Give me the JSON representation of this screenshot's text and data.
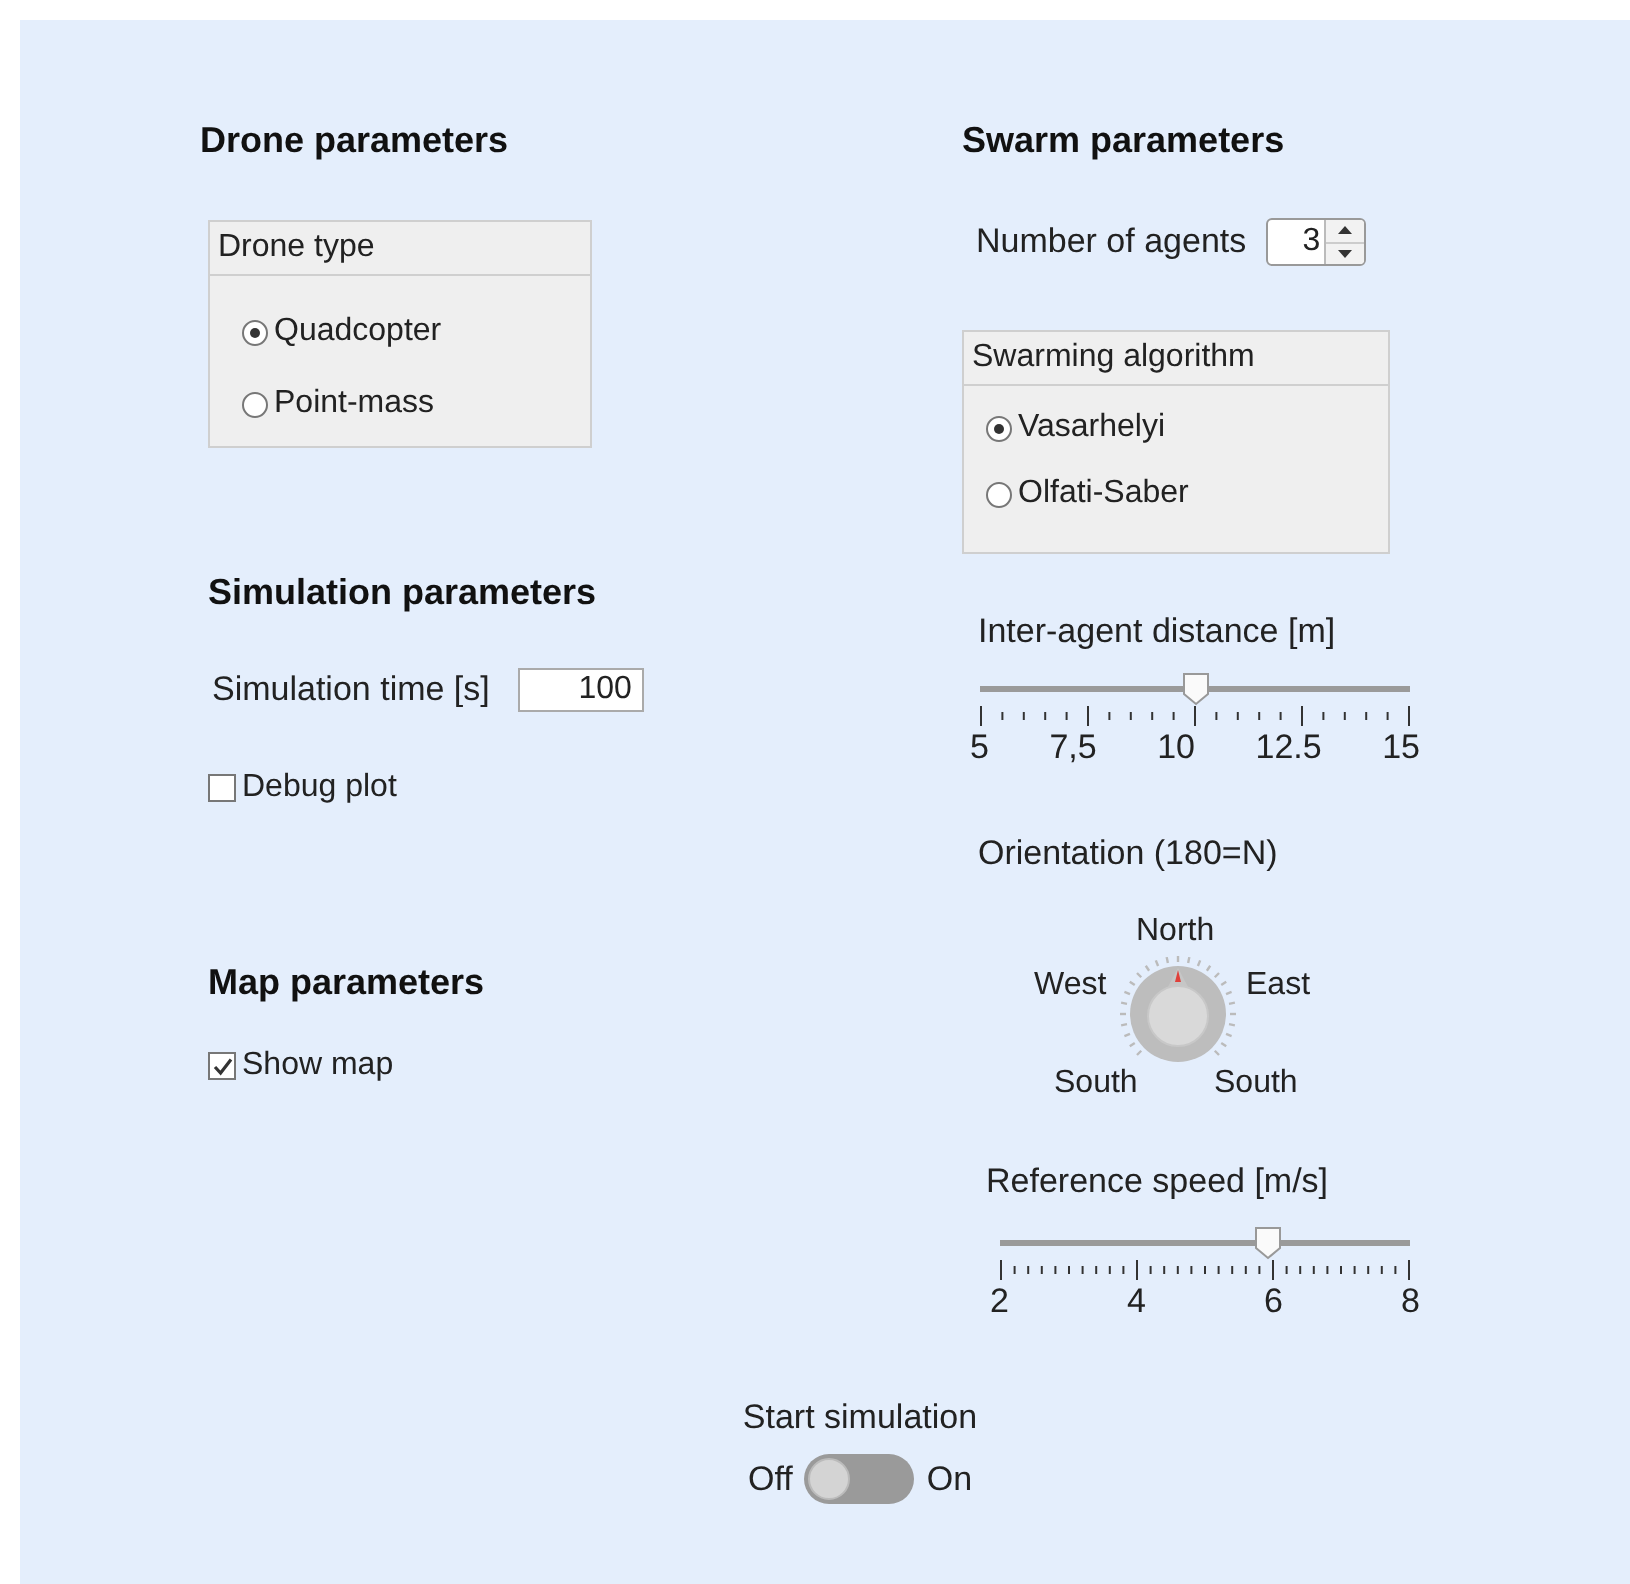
{
  "drone_parameters": {
    "heading": "Drone parameters",
    "drone_type": {
      "title": "Drone type",
      "options": [
        {
          "label": "Quadcopter",
          "selected": true
        },
        {
          "label": "Point-mass",
          "selected": false
        }
      ]
    }
  },
  "simulation_parameters": {
    "heading": "Simulation parameters",
    "simulation_time": {
      "label": "Simulation time [s]",
      "value": "100"
    },
    "debug_plot": {
      "label": "Debug plot",
      "checked": false
    }
  },
  "map_parameters": {
    "heading": "Map parameters",
    "show_map": {
      "label": "Show map",
      "checked": true
    }
  },
  "swarm_parameters": {
    "heading": "Swarm parameters",
    "number_of_agents": {
      "label": "Number of agents",
      "value": "3"
    },
    "swarming_algorithm": {
      "title": "Swarming algorithm",
      "options": [
        {
          "label": "Vasarhelyi",
          "selected": true
        },
        {
          "label": "Olfati-Saber",
          "selected": false
        }
      ]
    },
    "inter_agent_distance": {
      "label": "Inter-agent distance [m]",
      "level": 0.5,
      "tick_labels": [
        "5",
        "7,5",
        "10",
        "12.5",
        "15"
      ]
    },
    "orientation": {
      "label": "Orientation (180=N)",
      "level": 0.5,
      "dial_labels": {
        "north": "North",
        "west": "West",
        "east": "East",
        "south_left": "South",
        "south_right": "South"
      }
    },
    "reference_speed": {
      "label": "Reference speed [m/s]",
      "level": 0.667,
      "tick_labels": [
        "2",
        "4",
        "6",
        "8"
      ]
    }
  },
  "start_simulation": {
    "label": "Start simulation",
    "off_label": "Off",
    "on_label": "On",
    "on": false
  }
}
